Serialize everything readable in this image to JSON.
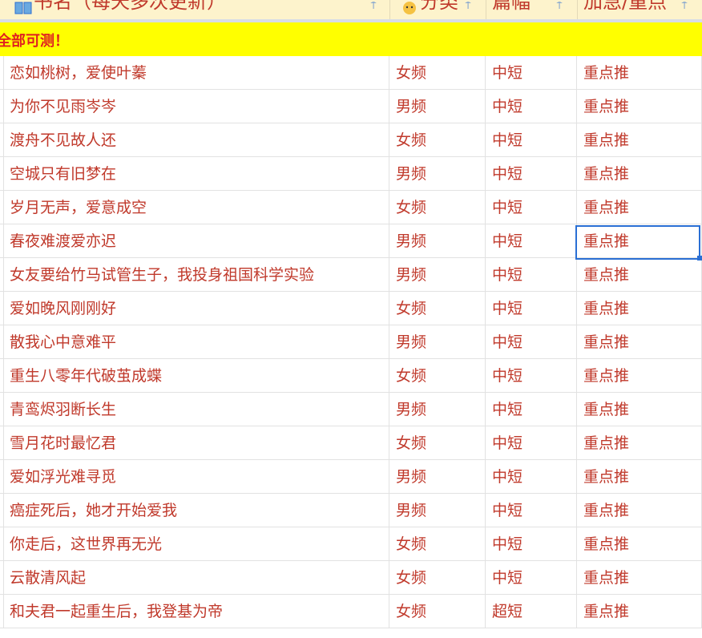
{
  "header": {
    "col1_label": "书名（每天多次更新）",
    "col2_label": "分类",
    "col3_label": "篇幅",
    "col4_label": "加急/重点",
    "filter_icon": "filter-icon",
    "book_icon": "book-icon",
    "emoji_icon": "smile-emoji-icon"
  },
  "banner": {
    "text": "全部可测！"
  },
  "rows": [
    {
      "title": "恋如桃树，爱使叶蓁",
      "category": "女频",
      "length": "中短",
      "priority": "重点推"
    },
    {
      "title": "为你不见雨岑岑",
      "category": "男频",
      "length": "中短",
      "priority": "重点推"
    },
    {
      "title": "渡舟不见故人还",
      "category": "女频",
      "length": "中短",
      "priority": "重点推"
    },
    {
      "title": "空城只有旧梦在",
      "category": "男频",
      "length": "中短",
      "priority": "重点推"
    },
    {
      "title": "岁月无声，爱意成空",
      "category": "女频",
      "length": "中短",
      "priority": "重点推"
    },
    {
      "title": "春夜难渡爱亦迟",
      "category": "男频",
      "length": "中短",
      "priority": "重点推"
    },
    {
      "title": "女友要给竹马试管生子，我投身祖国科学实验",
      "category": "男频",
      "length": "中短",
      "priority": "重点推"
    },
    {
      "title": "爱如晚风刚刚好",
      "category": "女频",
      "length": "中短",
      "priority": "重点推"
    },
    {
      "title": "散我心中意难平",
      "category": "男频",
      "length": "中短",
      "priority": "重点推"
    },
    {
      "title": "重生八零年代破茧成蝶",
      "category": "女频",
      "length": "中短",
      "priority": "重点推"
    },
    {
      "title": "青鸾烬羽断长生",
      "category": "男频",
      "length": "中短",
      "priority": "重点推"
    },
    {
      "title": "雪月花时最忆君",
      "category": "女频",
      "length": "中短",
      "priority": "重点推"
    },
    {
      "title": "爱如浮光难寻觅",
      "category": "男频",
      "length": "中短",
      "priority": "重点推"
    },
    {
      "title": "癌症死后，她才开始爱我",
      "category": "男频",
      "length": "中短",
      "priority": "重点推"
    },
    {
      "title": "你走后，这世界再无光",
      "category": "女频",
      "length": "中短",
      "priority": "重点推"
    },
    {
      "title": "云散清风起",
      "category": "女频",
      "length": "中短",
      "priority": "重点推"
    },
    {
      "title": "和夫君一起重生后，我登基为帝",
      "category": "女频",
      "length": "超短",
      "priority": "重点推"
    }
  ],
  "selected_cell": {
    "row": 6,
    "column": "priority"
  },
  "colors": {
    "text": "#c0392b",
    "banner_bg": "#ffff00",
    "banner_text": "#e02020",
    "header_bg": "#fdf3cc",
    "selection": "#2a6fd4"
  }
}
